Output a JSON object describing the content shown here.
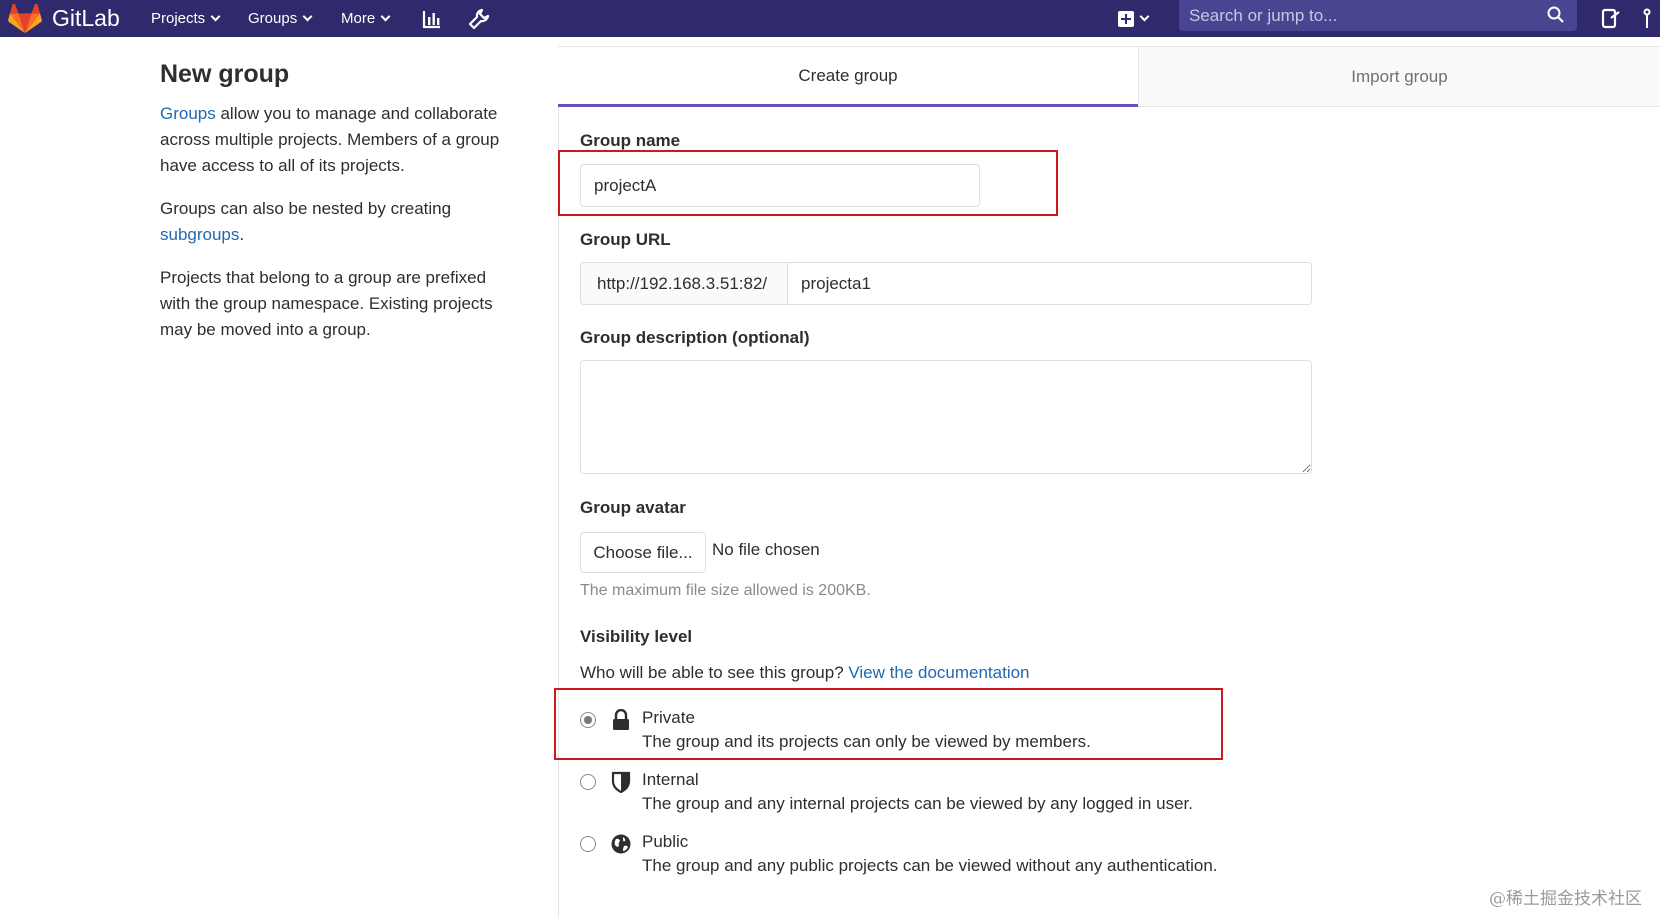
{
  "navbar": {
    "brand": "GitLab",
    "menus": [
      {
        "label": "Projects"
      },
      {
        "label": "Groups"
      },
      {
        "label": "More"
      }
    ],
    "search_placeholder": "Search or jump to...",
    "icons": [
      "gitlab-logo",
      "chevron-down-icon",
      "chart-icon",
      "wrench-icon",
      "plus-square-icon",
      "search-icon",
      "todo-icon",
      "merge-request-icon"
    ]
  },
  "sidebar": {
    "title": "New group",
    "p1_link": "Groups",
    "p1_text": " allow you to manage and collaborate across multiple projects. Members of a group have access to all of its projects.",
    "p2_text": "Groups can also be nested by creating ",
    "p2_link": "subgroups",
    "p2_end": ".",
    "p3_text": "Projects that belong to a group are prefixed with the group namespace. Existing projects may be moved into a group."
  },
  "tabs": [
    {
      "label": "Create group",
      "active": true
    },
    {
      "label": "Import group",
      "active": false
    }
  ],
  "form": {
    "group_name_label": "Group name",
    "group_name_value": "projectA",
    "group_url_label": "Group URL",
    "group_url_prefix": "http://192.168.3.51:82/",
    "group_url_path": "projecta1",
    "description_label": "Group description (optional)",
    "description_value": "",
    "avatar_label": "Group avatar",
    "choose_file": "Choose file...",
    "no_file": "No file chosen",
    "avatar_help": "The maximum file size allowed is 200KB.",
    "visibility_label": "Visibility level",
    "visibility_question": "Who will be able to see this group? ",
    "visibility_doc_link": "View the documentation",
    "visibility_options": [
      {
        "title": "Private",
        "desc": "The group and its projects can only be viewed by members.",
        "checked": true,
        "icon": "lock-icon"
      },
      {
        "title": "Internal",
        "desc": "The group and any internal projects can be viewed by any logged in user.",
        "checked": false,
        "icon": "shield-icon"
      },
      {
        "title": "Public",
        "desc": "The group and any public projects can be viewed without any authentication.",
        "checked": false,
        "icon": "globe-icon"
      }
    ]
  },
  "watermark": "@稀土掘金技术社区",
  "colors": {
    "navbar": "#2f2a6b",
    "search_bg": "#4a4590",
    "link": "#1f69b1",
    "active_tab": "#6b4fbb",
    "highlight": "#d0161e"
  }
}
